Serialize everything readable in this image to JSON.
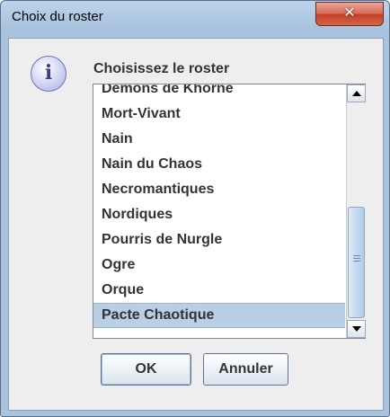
{
  "window": {
    "title": "Choix du roster",
    "close_glyph": "✕"
  },
  "dialog": {
    "icon": "info-icon",
    "icon_glyph": "i",
    "prompt": "Choisissez le roster",
    "roster_list": {
      "items": [
        "Démons de Khorne",
        "Mort-Vivant",
        "Nain",
        "Nain du Chaos",
        "Necromantiques",
        "Nordiques",
        "Pourris de Nurgle",
        "Ogre",
        "Orque",
        "Pacte Chaotique"
      ],
      "selected": "Pacte Chaotique"
    },
    "buttons": {
      "ok": "OK",
      "cancel": "Annuler"
    }
  },
  "colors": {
    "selection": "#b8cfe5",
    "close_button": "#c33f26",
    "title_bar": "#bcd3ea"
  }
}
